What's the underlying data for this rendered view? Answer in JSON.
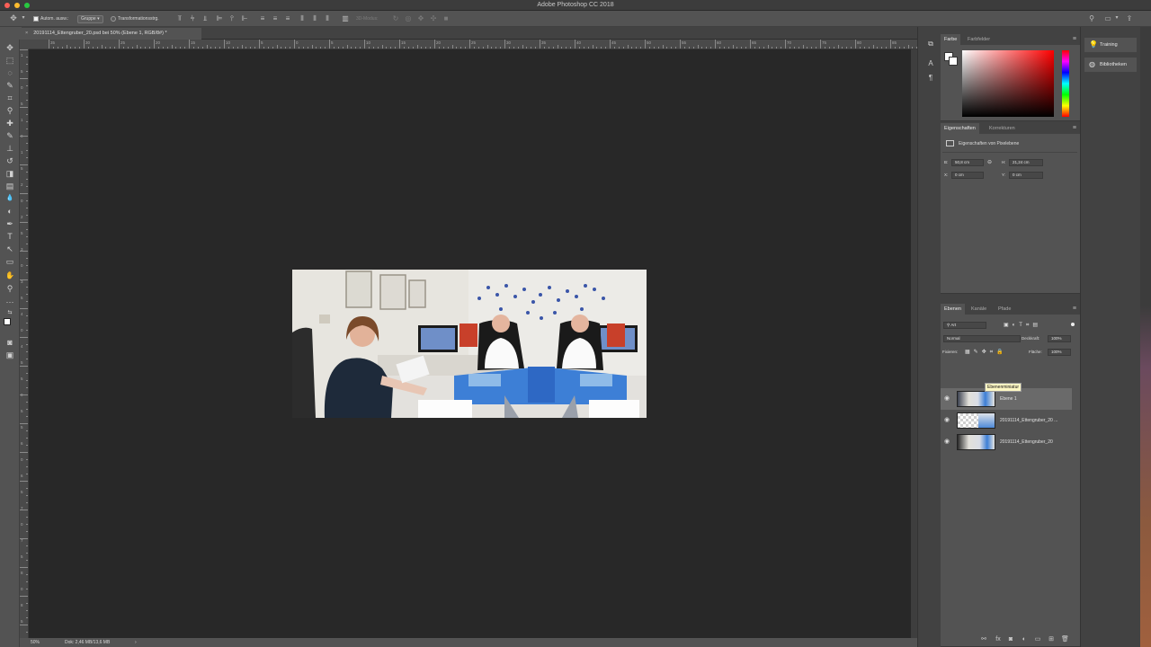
{
  "window": {
    "title": "Adobe Photoshop CC 2018"
  },
  "options_bar": {
    "auto_select_label": "Autom. ausw.:",
    "auto_select_value": "Gruppe",
    "transform_label": "Transformationsstrg.",
    "mode_3d_label": "3D-Modus:"
  },
  "document": {
    "tab_title": "20191114_Ettengruber_20.psd bei 50% (Ebene 1, RGB/8#) *",
    "tab_close": "×"
  },
  "rulers": {
    "top": [
      "35",
      "30",
      "25",
      "20",
      "15",
      "10",
      "5",
      "0",
      "5",
      "10",
      "15",
      "20",
      "25",
      "30",
      "35",
      "40",
      "45",
      "50",
      "55",
      "60",
      "65",
      "70",
      "75",
      "80",
      "85"
    ],
    "left": [
      "1",
      "5",
      "0",
      "5",
      "1",
      "0",
      "1",
      "5",
      "2",
      "0",
      "2",
      "5",
      "3",
      "0",
      "3",
      "5",
      "4",
      "0",
      "4",
      "5",
      "5",
      "0",
      "5",
      "5",
      "6",
      "0",
      "6",
      "5",
      "7",
      "0",
      "7",
      "5",
      "8",
      "0",
      "8",
      "5"
    ]
  },
  "status": {
    "zoom": "50%",
    "doc": "Dok: 2,46 MB/13,6 MB",
    "arrow": "›"
  },
  "color_panel": {
    "tabs": [
      "Farbe",
      "Farbfelder"
    ],
    "fg": "#ffffff",
    "bg": "#ffffff",
    "menu": "≡"
  },
  "properties_panel": {
    "tabs": [
      "Eigenschaften",
      "Korrekturen"
    ],
    "heading": "Eigenschaften von Pixelebene",
    "b_label": "B:",
    "b_value": "50,8 cm",
    "h_label": "H:",
    "h_value": "21,24 cm",
    "x_label": "X:",
    "x_value": "0 cm",
    "y_label": "Y:",
    "y_value": "0 cm",
    "link_icon": "⊖"
  },
  "layers_panel": {
    "tabs": [
      "Ebenen",
      "Kanäle",
      "Pfade"
    ],
    "filter": "Art",
    "blend_mode": "Normal",
    "opacity_label": "Deckkraft:",
    "opacity_value": "100%",
    "lock_label": "Fixieren:",
    "fill_label": "Fläche:",
    "fill_value": "100%",
    "layers": [
      {
        "name": "Ebene 1",
        "selected": true
      },
      {
        "name": "20191114_Ettengruber_20 ...",
        "selected": false
      },
      {
        "name": "20191114_Ettengruber_20",
        "selected": false
      }
    ],
    "tooltip": "Ebenenminiatur"
  },
  "right_tabs": {
    "training": "Training",
    "libraries": "Bibliotheken"
  },
  "icons": {
    "move": "✥",
    "marquee": "⬚",
    "lasso": "◌",
    "quick_select": "✎",
    "crop": "⌗",
    "eyedropper": "⚲",
    "heal": "✚",
    "brush": "✎",
    "stamp": "⊥",
    "history": "↺",
    "eraser": "◨",
    "gradient": "▤",
    "blur": "💧",
    "dodge": "◐",
    "pen": "✒",
    "type": "T",
    "path_select": "↖",
    "shape": "▭",
    "hand": "✋",
    "zoom": "⚲",
    "more": "···",
    "eye": "👁"
  }
}
